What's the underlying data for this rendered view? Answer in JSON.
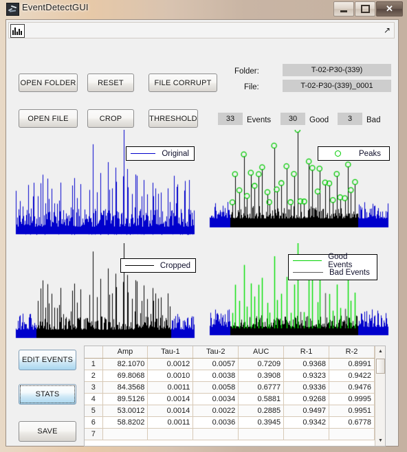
{
  "window": {
    "title": "EventDetectGUI",
    "icon": "matlab-icon",
    "buttons": {
      "minimize": "minimize-button",
      "maximize": "maximize-button",
      "close": "✕"
    }
  },
  "toolbar": {
    "plot_tool_icon": "data-cursor-icon",
    "overflow_icon": "↖"
  },
  "controls": {
    "open_folder": "OPEN FOLDER",
    "reset": "RESET",
    "file_corrupt": "FILE CORRUPT",
    "open_file": "OPEN FILE",
    "crop": "CROP",
    "threshold": "THRESHOLD",
    "edit_events": "EDIT EVENTS",
    "stats": "STATS",
    "save": "SAVE"
  },
  "info": {
    "folder_label": "Folder:",
    "folder_value": "T-02-P30-(339)",
    "file_label": "File:",
    "file_value": "T-02-P30-(339)_0001"
  },
  "counters": {
    "events_value": "33",
    "events_label": "Events",
    "good_value": "30",
    "good_label": "Good",
    "bad_value": "3",
    "bad_label": "Bad"
  },
  "plots": {
    "original": {
      "legend": "Original",
      "line_color": "#0000cc"
    },
    "peaks": {
      "legend": "Peaks",
      "marker_color": "#00cc00",
      "trace_color": "#000000",
      "edge_color": "#0000cc"
    },
    "cropped": {
      "legend": "Cropped",
      "line_color": "#000000",
      "edge_color": "#0000cc"
    },
    "events": {
      "legend_good": "Good Events",
      "legend_bad": "Bad Events",
      "good_color": "#00e000",
      "bad_color": "#5a5a5a",
      "trace_color": "#000000",
      "edge_color": "#0000cc"
    }
  },
  "table": {
    "columns": [
      "",
      "Amp",
      "Tau-1",
      "Tau-2",
      "AUC",
      "R-1",
      "R-2"
    ],
    "rows": [
      [
        "1",
        "82.1070",
        "0.0012",
        "0.0057",
        "0.7209",
        "0.9368",
        "0.8991"
      ],
      [
        "2",
        "69.8068",
        "0.0010",
        "0.0038",
        "0.3908",
        "0.9323",
        "0.9422"
      ],
      [
        "3",
        "84.3568",
        "0.0011",
        "0.0058",
        "0.6777",
        "0.9336",
        "0.9476"
      ],
      [
        "4",
        "89.5126",
        "0.0014",
        "0.0034",
        "0.5881",
        "0.9268",
        "0.9995"
      ],
      [
        "5",
        "53.0012",
        "0.0014",
        "0.0022",
        "0.2885",
        "0.9497",
        "0.9951"
      ],
      [
        "6",
        "58.8202",
        "0.0011",
        "0.0036",
        "0.3945",
        "0.9342",
        "0.6778"
      ],
      [
        "7",
        "",
        "",
        "",
        "",
        "",
        ""
      ]
    ],
    "scroll_up": "▲",
    "scroll_down": "▼"
  }
}
